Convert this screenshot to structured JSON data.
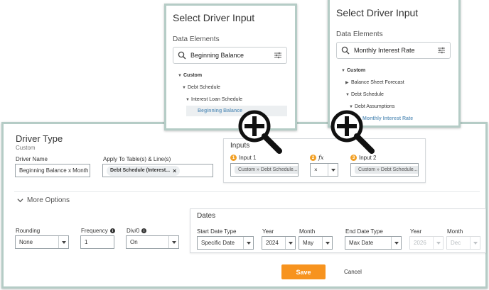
{
  "popup_left": {
    "title": "Select Driver Input",
    "section": "Data Elements",
    "search_value": "Beginning Balance",
    "tree": [
      {
        "label": "Custom",
        "expanded": true
      },
      {
        "label": "Debt Schedule",
        "expanded": true
      },
      {
        "label": "Interest Loan Schedule",
        "expanded": true
      },
      {
        "label": "Beginning Balance",
        "selected": true
      }
    ]
  },
  "popup_right": {
    "title": "Select Driver Input",
    "section": "Data Elements",
    "search_value": "Monthly Interest Rate",
    "tree": [
      {
        "label": "Custom",
        "expanded": true
      },
      {
        "label": "Balance Sheet Forecast",
        "expanded": false
      },
      {
        "label": "Debt Schedule",
        "expanded": true
      },
      {
        "label": "Debt Assumptions",
        "expanded": true
      },
      {
        "label": "Monthly Interest Rate",
        "selected": true
      }
    ]
  },
  "driver": {
    "title": "Driver Type",
    "subtitle": "Custom",
    "name_label": "Driver Name",
    "name_value": "Beginning Balance x Month",
    "apply_label": "Apply To Table(s) & Line(s)",
    "apply_chip": "Debt Schedule (Interest...",
    "apply_chip_close": "×"
  },
  "inputs": {
    "title": "Inputs",
    "input1_badge": "1",
    "input1_label": "Input 1",
    "input1_value": "Custom » Debt Schedule...",
    "fx_badge": "2",
    "fx_label": "fx",
    "fx_value": "×",
    "input2_badge": "3",
    "input2_label": "Input 2",
    "input2_value": "Custom » Debt Schedule..."
  },
  "more_options": {
    "label": "More Options",
    "rounding_label": "Rounding",
    "rounding_value": "None",
    "frequency_label": "Frequency",
    "frequency_value": "1",
    "div0_label": "Div/0",
    "div0_value": "On"
  },
  "dates": {
    "title": "Dates",
    "start_type_label": "Start Date Type",
    "start_type_value": "Specific Date",
    "start_year_label": "Year",
    "start_year_value": "2024",
    "start_month_label": "Month",
    "start_month_value": "May",
    "end_type_label": "End Date Type",
    "end_type_value": "Max Date",
    "end_year_label": "Year",
    "end_year_value": "2026",
    "end_month_label": "Month",
    "end_month_value": "Dec"
  },
  "actions": {
    "save": "Save",
    "cancel": "Cancel"
  },
  "colors": {
    "accent": "#f7931e",
    "frame": "#b5ccc6",
    "link": "#6a9bc0"
  }
}
